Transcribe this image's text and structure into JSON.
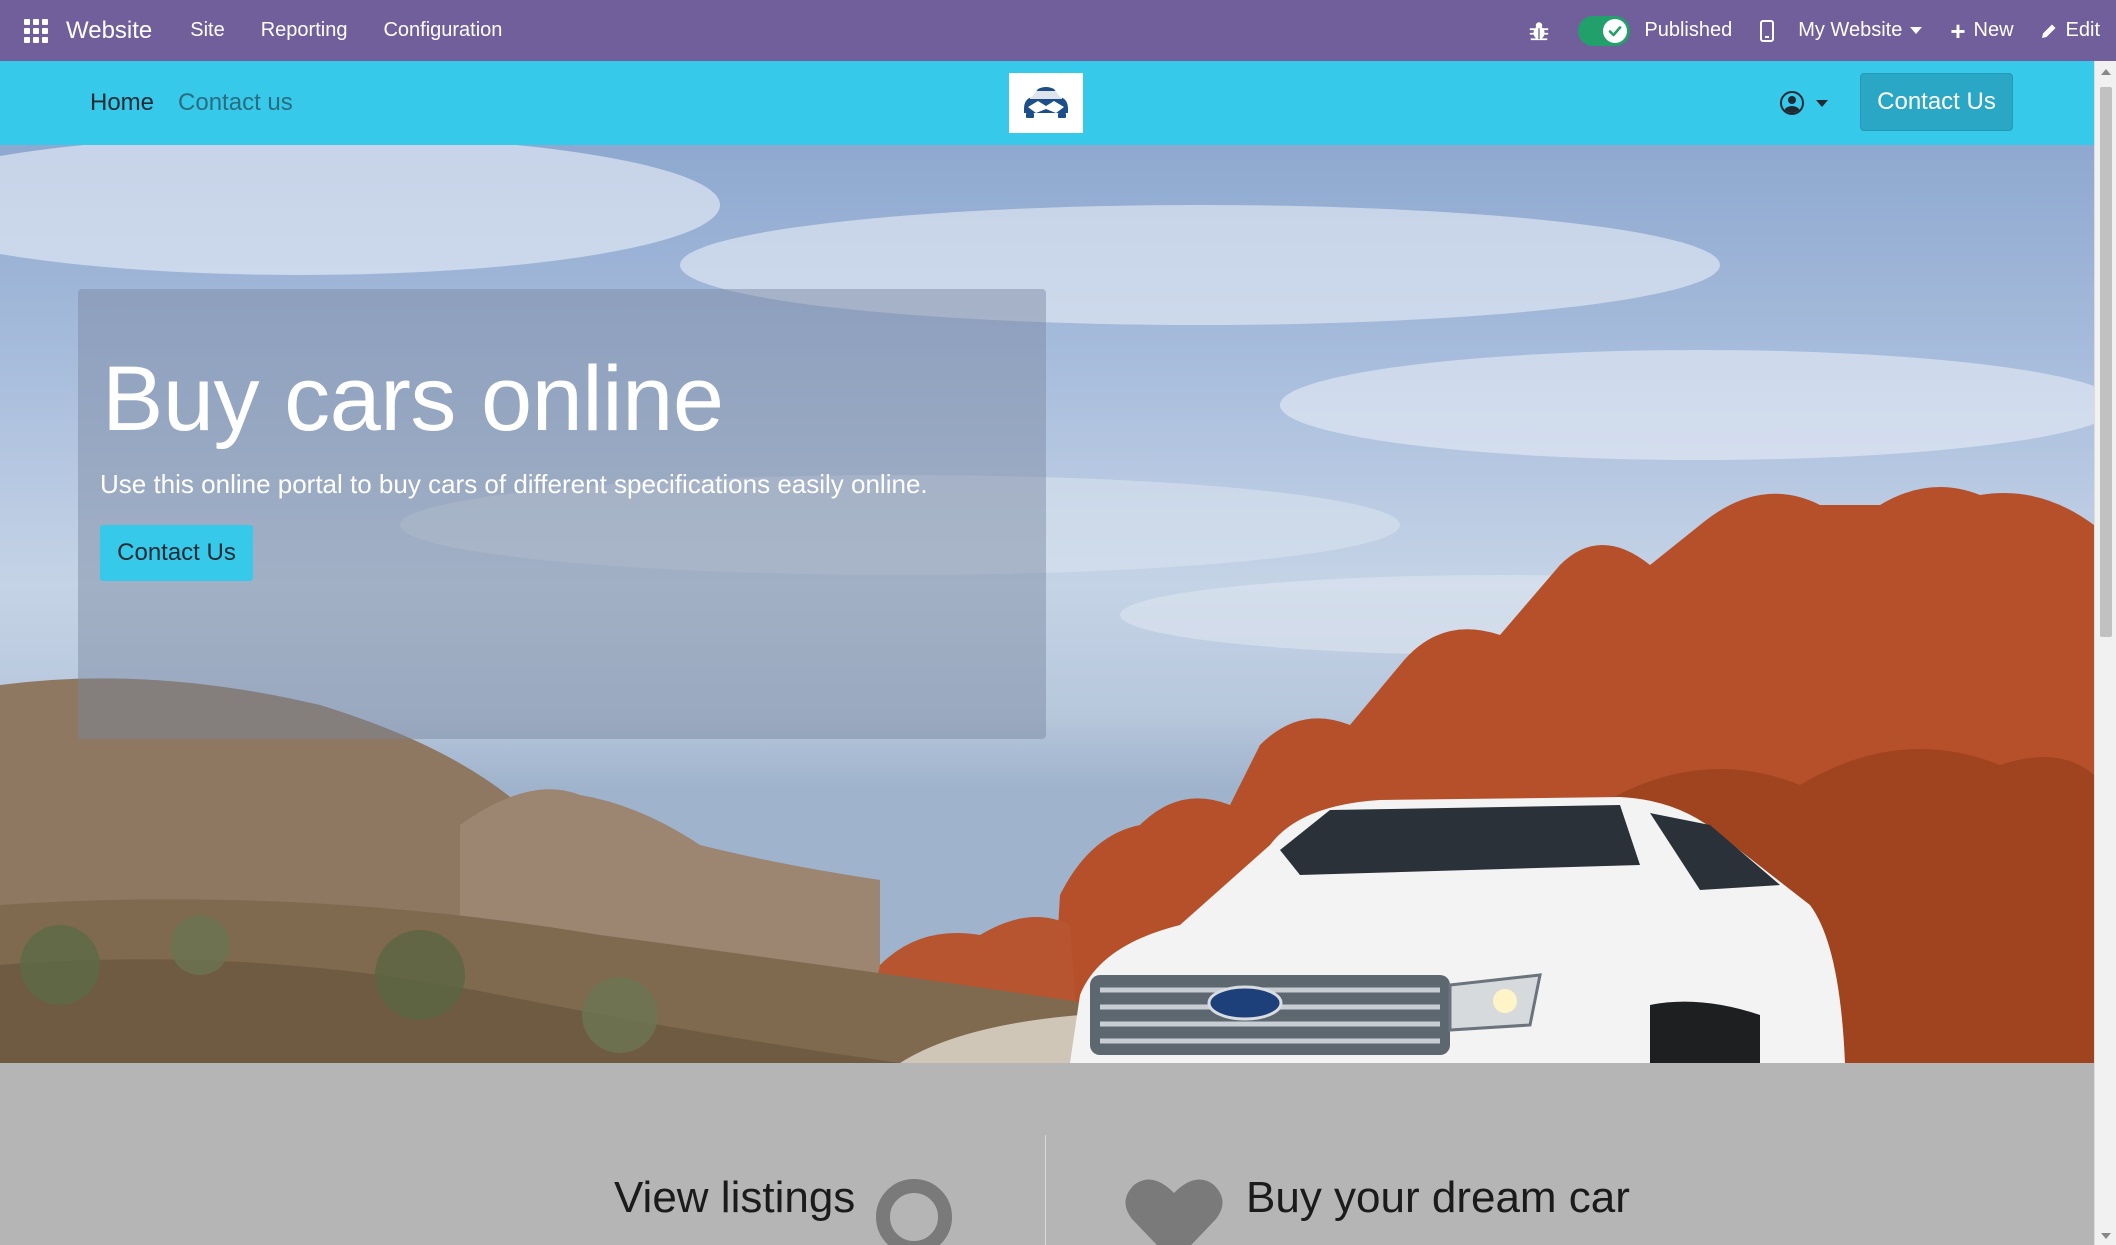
{
  "admin_bar": {
    "app_name": "Website",
    "menu": [
      "Site",
      "Reporting",
      "Configuration"
    ],
    "published_label": "Published",
    "site_switch_label": "My Website",
    "new_label": "New",
    "edit_label": "Edit",
    "background_color": "#715f9c",
    "toggle_color": "#21a06c",
    "icons": [
      "apps-grid-icon",
      "bug-icon",
      "check-icon",
      "mobile-icon",
      "plus-icon",
      "pencil-icon"
    ]
  },
  "site_header": {
    "nav": [
      "Home",
      "Contact us"
    ],
    "cta_label": "Contact Us",
    "background_color": "#36c9ea",
    "icons": [
      "car-handshake-logo",
      "user-circle-icon",
      "caret-down-icon"
    ]
  },
  "hero": {
    "title": "Buy cars online",
    "subtitle": "Use this online portal to buy cars of different specifications easily online.",
    "button_label": "Contact Us",
    "image_description": "white SUV on desert road with red rock formations"
  },
  "features": {
    "left_title": "View listings",
    "right_title": "Buy your dream car",
    "icons": [
      "search-icon",
      "heart-icon"
    ]
  }
}
